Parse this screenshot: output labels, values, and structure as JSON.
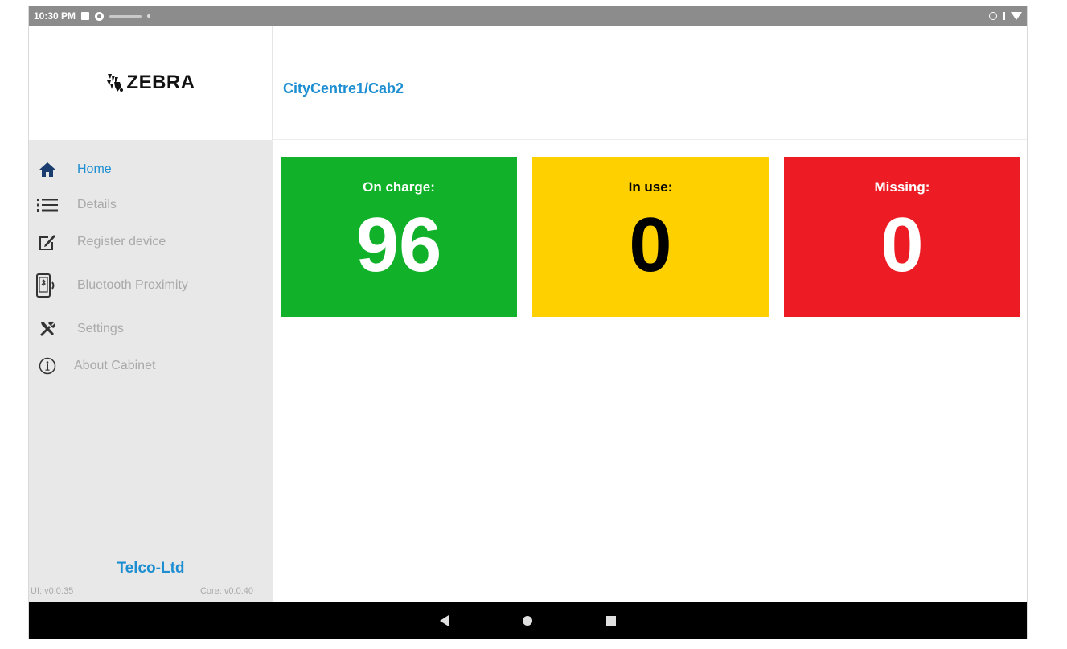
{
  "status_bar": {
    "time": "10:30 PM"
  },
  "logo": {
    "text": "ZEBRA"
  },
  "header": {
    "breadcrumb": "CityCentre1/Cab2"
  },
  "sidebar": {
    "items": [
      {
        "label": "Home",
        "icon": "home-icon",
        "active": true
      },
      {
        "label": "Details",
        "icon": "list-icon",
        "active": false
      },
      {
        "label": "Register device",
        "icon": "edit-icon",
        "active": false
      },
      {
        "label": "Bluetooth Proximity",
        "icon": "bluetooth-proximity-icon",
        "active": false
      },
      {
        "label": "Settings",
        "icon": "tools-icon",
        "active": false
      },
      {
        "label": "About Cabinet",
        "icon": "info-icon",
        "active": false
      }
    ],
    "tenant": "Telco-Ltd",
    "ui_version": "UI: v0.0.35",
    "core_version": "Core: v0.0.40"
  },
  "tiles": [
    {
      "label": "On charge:",
      "value": "96",
      "bg": "#11b22a",
      "fg": "#ffffff"
    },
    {
      "label": "In use:",
      "value": "0",
      "bg": "#ffd000",
      "fg": "#000000"
    },
    {
      "label": "Missing:",
      "value": "0",
      "bg": "#ed1c24",
      "fg": "#ffffff"
    }
  ],
  "colors": {
    "accent": "#1d8ed1",
    "sidebar_bg": "#e8e8e8"
  }
}
